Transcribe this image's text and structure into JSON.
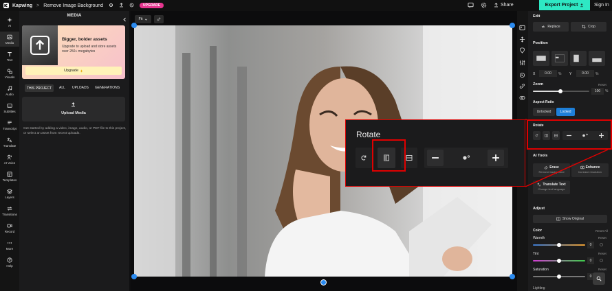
{
  "topbar": {
    "brand": "Kapwing",
    "separator": ">",
    "project_title": "Remove Image Background",
    "upgrade_label": "UPGRADE",
    "share_label": "Share",
    "export_label": "Export Project",
    "signin_label": "Sign In"
  },
  "leftnav": {
    "items": [
      {
        "label": "AI"
      },
      {
        "label": "Media"
      },
      {
        "label": "Text"
      },
      {
        "label": "Visuals"
      },
      {
        "label": "Audio"
      },
      {
        "label": "Subtitles"
      },
      {
        "label": "Transcript"
      },
      {
        "label": "Translate"
      },
      {
        "label": "AI Voice"
      },
      {
        "label": "Templates"
      },
      {
        "label": "Layers"
      },
      {
        "label": "Transitions"
      },
      {
        "label": "Record"
      },
      {
        "label": "More"
      },
      {
        "label": "Help"
      }
    ]
  },
  "media": {
    "title": "MEDIA",
    "promo_title": "Bigger, bolder assets",
    "promo_text": "Upgrade to upload and store assets over 250+ megabytes",
    "promo_button": "Upgrade",
    "tabs": [
      "THIS PROJECT",
      "ALL",
      "UPLOADS",
      "GENERATIONS"
    ],
    "upload_label": "Upload Media",
    "help_text": "Get started by adding a video, image, audio, or PDF file to this project, or select an asset from recent uploads."
  },
  "canvas": {
    "fit_label": "Fit"
  },
  "zoom_callout": {
    "title": "Rotate"
  },
  "right": {
    "edit_title": "Edit",
    "replace_label": "Replace",
    "crop_label": "Crop",
    "position_title": "Position",
    "x_label": "X",
    "x_value": "0.00",
    "y_label": "Y",
    "y_value": "0.00",
    "percent": "%",
    "zoom_title": "Zoom",
    "reset_label": "Reset",
    "zoom_value": "100",
    "aspect_title": "Aspect Ratio",
    "unlocked_label": "Unlocked",
    "locked_label": "Locked",
    "rotate_title": "Rotate",
    "ai_tools_title": "AI Tools",
    "erase_label": "Erase",
    "erase_sub": "Remove background",
    "enhance_label": "Enhance",
    "enhance_sub": "Increase resolution",
    "translate_label": "Translate Text",
    "translate_sub": "Change text language",
    "adjust_title": "Adjust",
    "show_original": "Show Original",
    "color_title": "Color",
    "reset_all": "Reset All",
    "warmth_label": "Warmth",
    "warmth_value": "0",
    "tint_label": "Tint",
    "tint_value": "0",
    "saturation_label": "Saturation",
    "saturation_value": "0",
    "lighting_label": "Lighting"
  },
  "colors": {
    "accent_teal": "#2ee8c4",
    "upgrade_pink": "#e6358f",
    "locked_blue": "#1e7fd8",
    "highlight_red": "#e00000"
  }
}
